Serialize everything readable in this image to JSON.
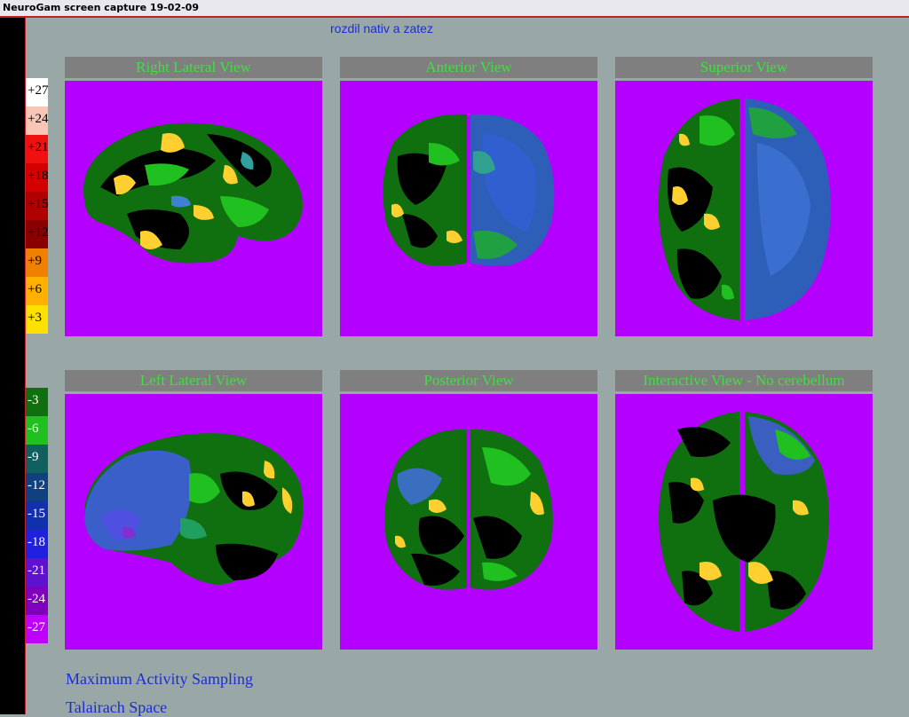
{
  "window": {
    "title": "NeuroGam screen capture 19-02-09"
  },
  "subtitle": "rozdil nativ a zatez",
  "scale_positive": [
    {
      "label": "+27",
      "color": "#ffffff",
      "text_color": "#000000"
    },
    {
      "label": "+24",
      "color": "#f7c6b6",
      "text_color": "#000000"
    },
    {
      "label": "+21",
      "color": "#f01010",
      "text_color": "#000000"
    },
    {
      "label": "+18",
      "color": "#d40000",
      "text_color": "#000000"
    },
    {
      "label": "+15",
      "color": "#b00000",
      "text_color": "#000000"
    },
    {
      "label": "+12",
      "color": "#8a0000",
      "text_color": "#000000"
    },
    {
      "label": "+9",
      "color": "#f08000",
      "text_color": "#000000"
    },
    {
      "label": "+6",
      "color": "#ffb000",
      "text_color": "#000000"
    },
    {
      "label": "+3",
      "color": "#ffe000",
      "text_color": "#000000"
    }
  ],
  "scale_negative": [
    {
      "label": "-3",
      "color": "#107010",
      "text_color": "#ffffff"
    },
    {
      "label": "-6",
      "color": "#20c020",
      "text_color": "#ffffff"
    },
    {
      "label": "-9",
      "color": "#106060",
      "text_color": "#ffffff"
    },
    {
      "label": "-12",
      "color": "#104080",
      "text_color": "#ffffff"
    },
    {
      "label": "-15",
      "color": "#1030b0",
      "text_color": "#ffffff"
    },
    {
      "label": "-18",
      "color": "#2020e0",
      "text_color": "#ffffff"
    },
    {
      "label": "-21",
      "color": "#6010d0",
      "text_color": "#ffffff"
    },
    {
      "label": "-24",
      "color": "#8000c0",
      "text_color": "#ffffff"
    },
    {
      "label": "-27",
      "color": "#c000ff",
      "text_color": "#ffffff"
    }
  ],
  "views": [
    {
      "title": "Right Lateral View"
    },
    {
      "title": "Anterior View"
    },
    {
      "title": "Superior View"
    },
    {
      "title": "Left Lateral View"
    },
    {
      "title": "Posterior View"
    },
    {
      "title": "Interactive View - No cerebellum"
    }
  ],
  "footer": {
    "line1": "Maximum Activity Sampling",
    "line2": "Talairach Space"
  },
  "colors": {
    "panel_bg": "#b400ff",
    "title_bar": "#7f7f7f",
    "title_text": "#3fe03f",
    "body_bg": "#9aa7a7"
  }
}
